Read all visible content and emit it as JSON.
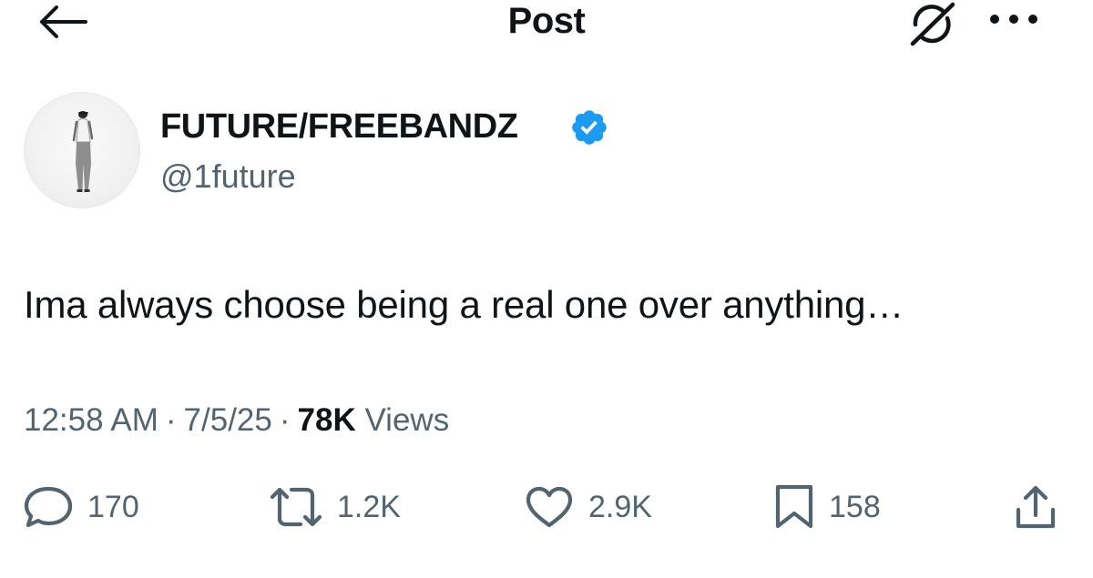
{
  "header": {
    "title": "Post",
    "back_icon": "arrow-left-icon",
    "grok_icon": "grok-icon",
    "more_icon": "more-horizontal-icon"
  },
  "author": {
    "display_name": "FUTURE/FREEBANDZ",
    "handle": "@1future",
    "verified_icon": "verified-badge-icon",
    "verified_color": "#1d9bf0"
  },
  "post": {
    "text": "Ima always choose being a real one over anything…"
  },
  "meta": {
    "time": "12:58 AM",
    "separator": "·",
    "date": "7/5/25",
    "views_count": "78K",
    "views_label": "Views"
  },
  "actions": {
    "reply": {
      "icon": "reply-icon",
      "count": "170"
    },
    "repost": {
      "icon": "repost-icon",
      "count": "1.2K"
    },
    "like": {
      "icon": "heart-icon",
      "count": "2.9K"
    },
    "bookmark": {
      "icon": "bookmark-icon",
      "count": "158"
    },
    "share": {
      "icon": "share-icon"
    }
  },
  "colors": {
    "text": "#0f1419",
    "secondary": "#536471",
    "accent": "#1d9bf0",
    "background": "#ffffff"
  }
}
